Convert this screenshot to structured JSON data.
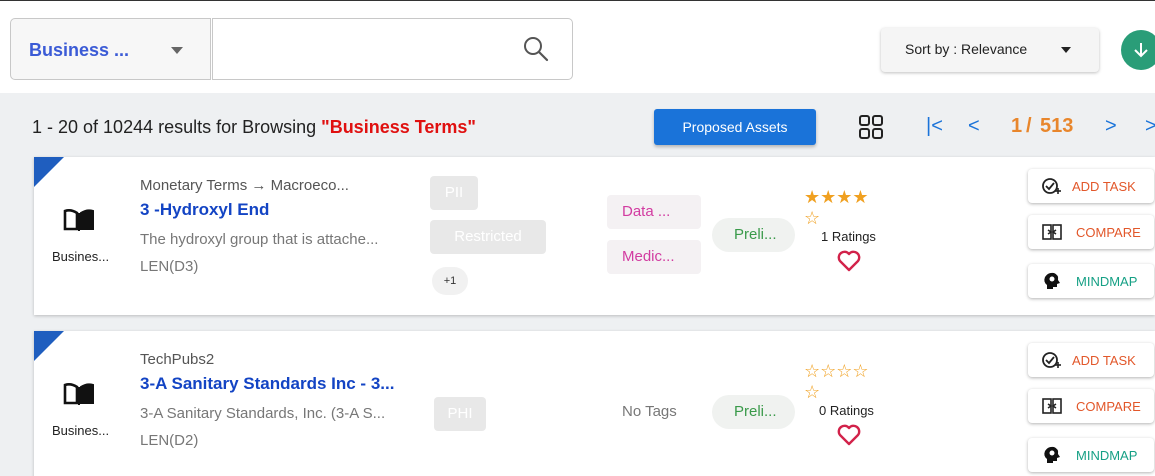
{
  "topbar": {
    "type_select_value": "Business ...",
    "search_placeholder": "",
    "sort_label": "Sort by : Relevance"
  },
  "results": {
    "summary_prefix": "1 - 20 of 10244 results for Browsing ",
    "summary_query": "\"Business Terms\"",
    "proposed_label": "Proposed Assets",
    "pager_first": "|<",
    "pager_prev": "<",
    "pager_current": "1",
    "pager_sep": "/",
    "pager_total": "513",
    "pager_next": ">",
    "pager_last": ">"
  },
  "cards": [
    {
      "type_label": "Busines...",
      "path": "Monetary Terms → Macroeco...",
      "title": "3 -Hydroxyl End",
      "description": "The hydroxyl group that is attache...",
      "formula": "LEN(D3)",
      "classifications": [
        "PII",
        "Restricted"
      ],
      "more": "+1",
      "tags": [
        "Data ...",
        "Medic..."
      ],
      "status": "Preli...",
      "rating_stars": 4,
      "ratings_text": "1 Ratings",
      "actions": {
        "task": "ADD TASK",
        "compare": "COMPARE",
        "mindmap": "MINDMAP"
      }
    },
    {
      "type_label": "Busines...",
      "path": "TechPubs2",
      "title": "3-A Sanitary Standards Inc - 3...",
      "description": "3-A Sanitary Standards, Inc. (3-A S...",
      "formula": "LEN(D2)",
      "classifications": [
        "PHI"
      ],
      "no_tags": "No Tags",
      "status": "Preli...",
      "rating_stars": 0,
      "ratings_text": "0 Ratings",
      "actions": {
        "task": "ADD TASK",
        "compare": "COMPARE",
        "mindmap": "MINDMAP"
      }
    }
  ],
  "colors": {
    "accent_blue": "#1a73d9",
    "query_red": "#e01010",
    "page_orange": "#e8862c",
    "star": "#f0a020",
    "heart": "#d2224a",
    "status_green": "#3a9a4a",
    "tag_pink": "#d23ca1",
    "download_green": "#2a9d78"
  }
}
